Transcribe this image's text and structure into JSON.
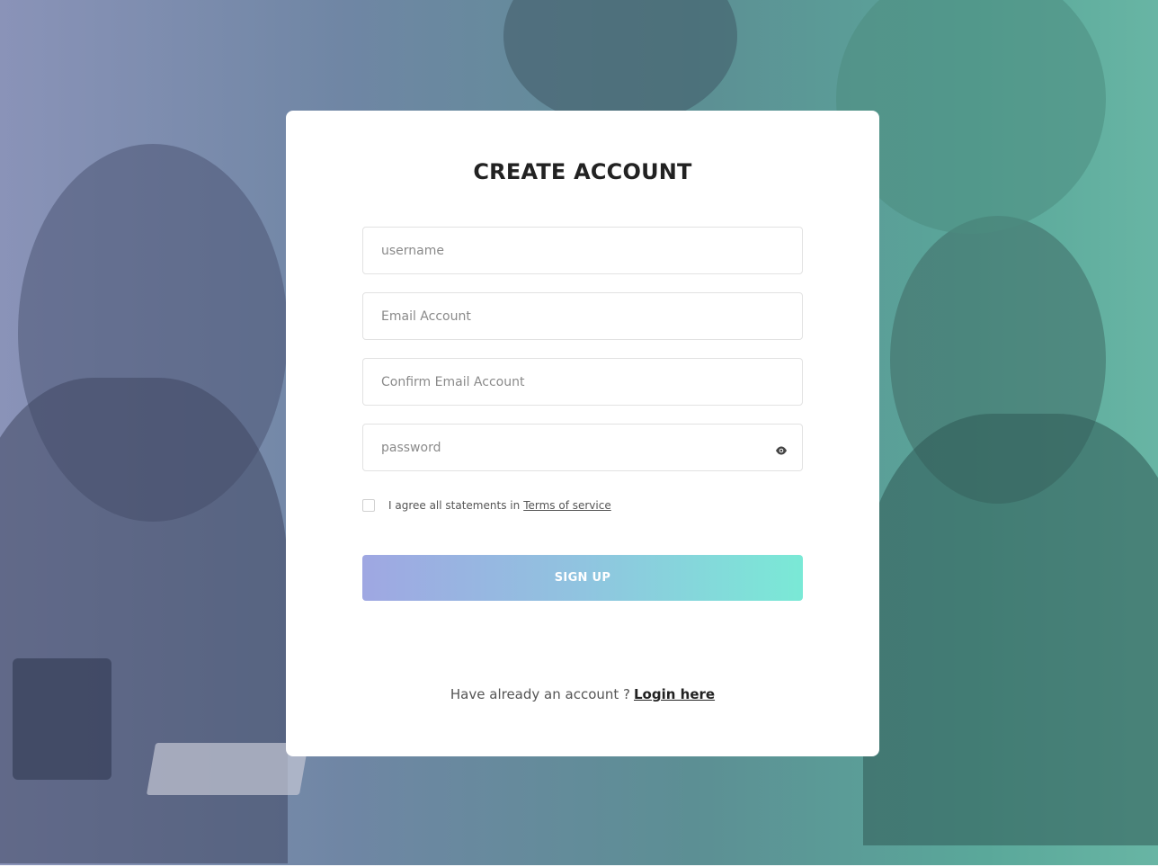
{
  "form": {
    "title": "CREATE ACCOUNT",
    "username_placeholder": "username",
    "email_placeholder": "Email Account",
    "confirm_email_placeholder": "Confirm Email Account",
    "password_placeholder": "password",
    "password_toggle_icon": "eye-icon",
    "agree_text": "I agree all statements in",
    "terms_link": "Terms of service",
    "agree_checked": false,
    "signup_label": "SIGN UP",
    "footer_text": "Have already an account ?",
    "login_link": "Login here"
  },
  "colors": {
    "button_gradient_start": "#9fa7e2",
    "button_gradient_end": "#7ae9d6",
    "background_left": "#8a93b8",
    "background_right": "#68b5a4"
  }
}
